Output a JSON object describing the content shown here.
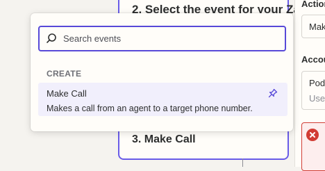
{
  "background": {
    "step2_heading": "2. Select the event for your Za",
    "step3_heading": "3. Make Call",
    "right_panel": {
      "action_label": "Action",
      "action_value": "Mak",
      "account_label": "Accou",
      "account_title": "Pod",
      "account_sub": "Use",
      "error_icon": "error-circle-icon"
    }
  },
  "popover": {
    "search": {
      "placeholder": "Search events",
      "value": "",
      "icon": "search-icon"
    },
    "section_title": "CREATE",
    "items": [
      {
        "title": "Make Call",
        "description": "Makes a call from an agent to a target phone number.",
        "icon": "pin-icon"
      }
    ]
  },
  "colors": {
    "accent": "#5749d8",
    "highlight": "#f1effc",
    "error": "#d13c34"
  }
}
